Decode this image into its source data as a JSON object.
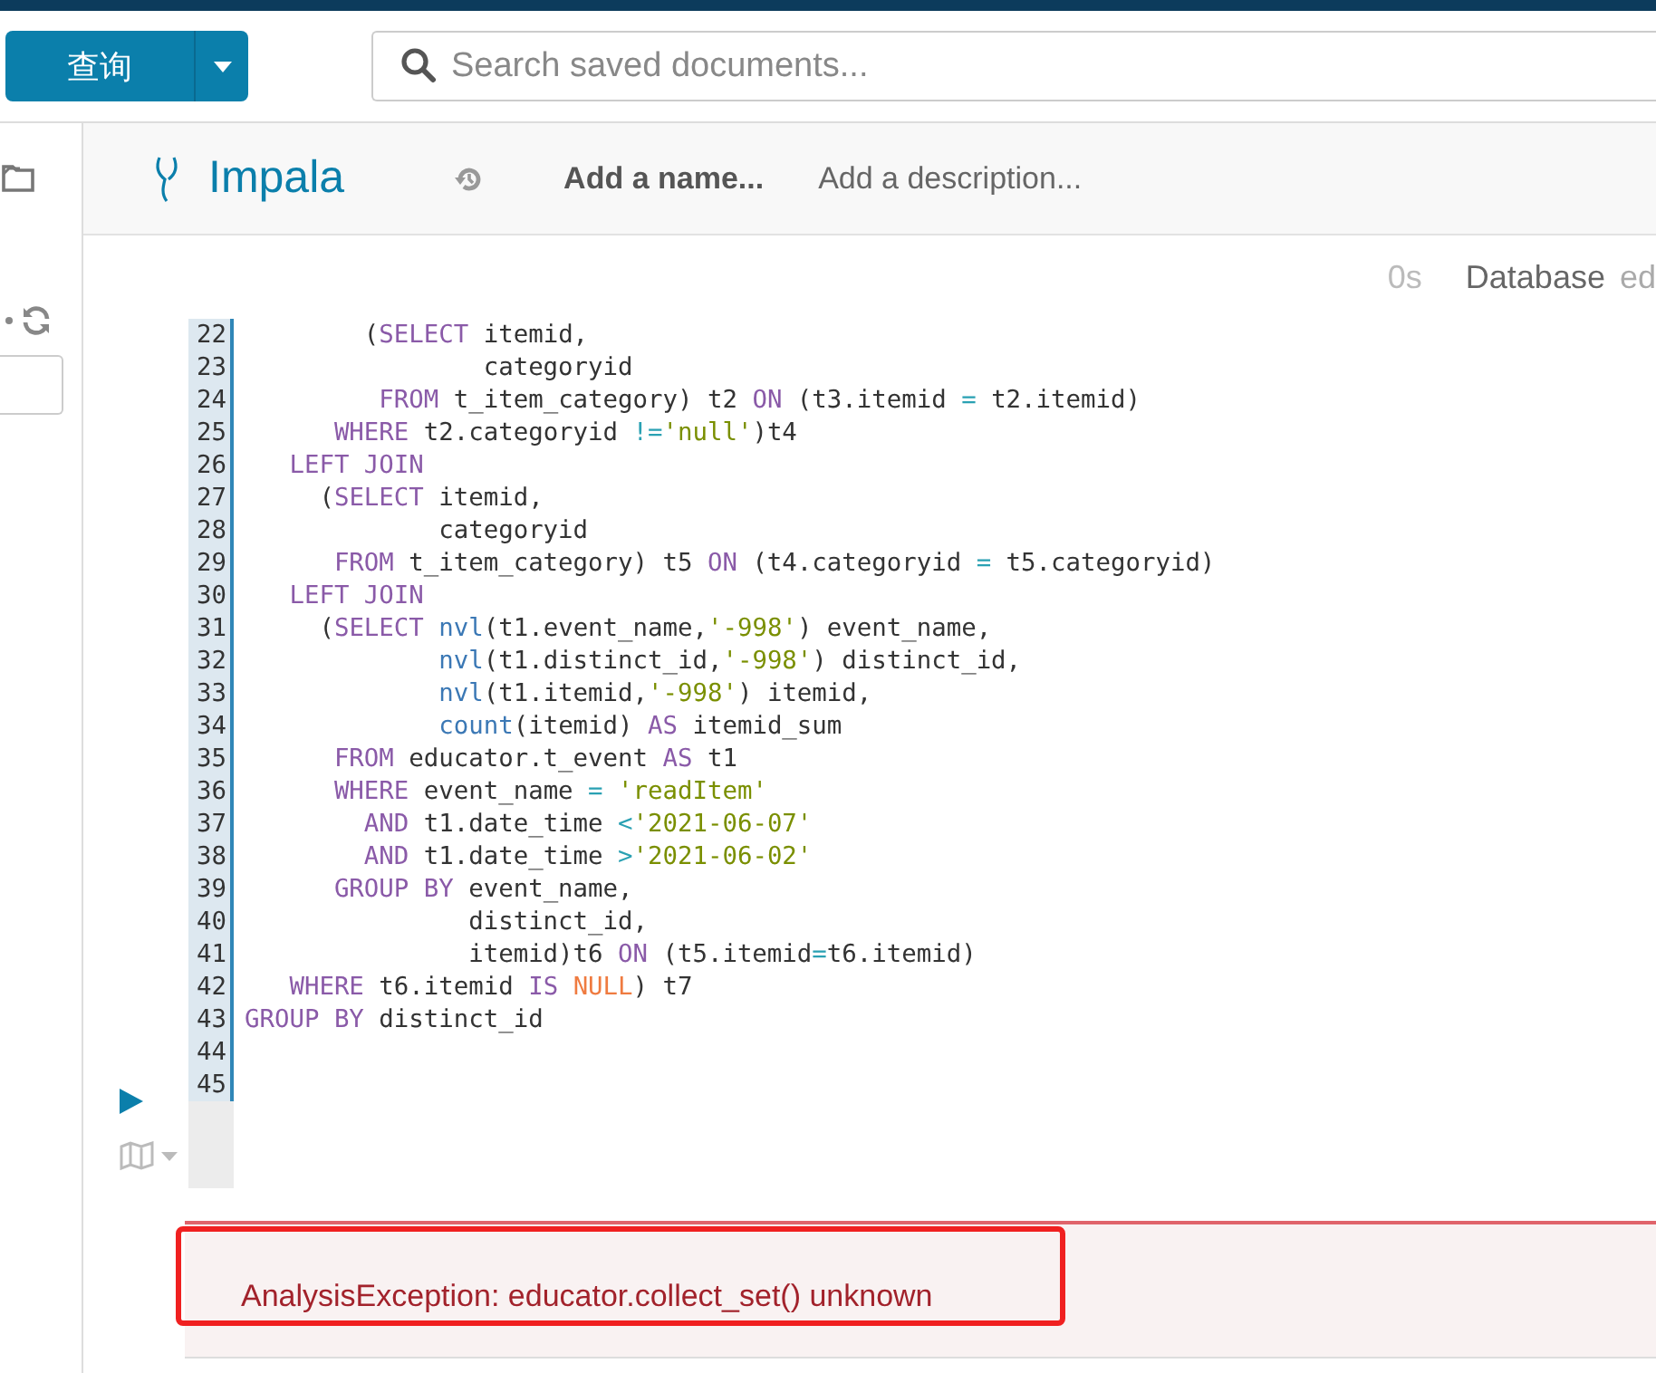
{
  "toolbar": {
    "query_button": "查询",
    "search": {
      "placeholder": "Search saved documents..."
    }
  },
  "editor_header": {
    "engine": "Impala",
    "name_placeholder": "Add a name...",
    "description_placeholder": "Add a description..."
  },
  "status": {
    "duration": "0s",
    "database_label": "Database",
    "database_value": "ed"
  },
  "code_lines": [
    {
      "number": "22",
      "segments": [
        {
          "kind": "plain",
          "text": "        ("
        },
        {
          "kind": "kw",
          "text": "SELECT"
        },
        {
          "kind": "plain",
          "text": " itemid,"
        }
      ]
    },
    {
      "number": "23",
      "segments": [
        {
          "kind": "plain",
          "text": "                categoryid"
        }
      ]
    },
    {
      "number": "24",
      "segments": [
        {
          "kind": "kw",
          "text": "         FROM"
        },
        {
          "kind": "plain",
          "text": " t_item_category) t2 "
        },
        {
          "kind": "kw",
          "text": "ON"
        },
        {
          "kind": "plain",
          "text": " (t3.itemid "
        },
        {
          "kind": "op",
          "text": "="
        },
        {
          "kind": "plain",
          "text": " t2.itemid)"
        }
      ]
    },
    {
      "number": "25",
      "segments": [
        {
          "kind": "kw",
          "text": "      WHERE"
        },
        {
          "kind": "plain",
          "text": " t2.categoryid "
        },
        {
          "kind": "op",
          "text": "!="
        },
        {
          "kind": "str",
          "text": "'null'"
        },
        {
          "kind": "plain",
          "text": ")t4"
        }
      ]
    },
    {
      "number": "26",
      "segments": [
        {
          "kind": "kw",
          "text": "   LEFT JOIN"
        }
      ]
    },
    {
      "number": "27",
      "segments": [
        {
          "kind": "plain",
          "text": "     ("
        },
        {
          "kind": "kw",
          "text": "SELECT"
        },
        {
          "kind": "plain",
          "text": " itemid,"
        }
      ]
    },
    {
      "number": "28",
      "segments": [
        {
          "kind": "plain",
          "text": "             categoryid"
        }
      ]
    },
    {
      "number": "29",
      "segments": [
        {
          "kind": "kw",
          "text": "      FROM"
        },
        {
          "kind": "plain",
          "text": " t_item_category) t5 "
        },
        {
          "kind": "kw",
          "text": "ON"
        },
        {
          "kind": "plain",
          "text": " (t4.categoryid "
        },
        {
          "kind": "op",
          "text": "="
        },
        {
          "kind": "plain",
          "text": " t5.categoryid)"
        }
      ]
    },
    {
      "number": "30",
      "segments": [
        {
          "kind": "kw",
          "text": "   LEFT JOIN"
        }
      ]
    },
    {
      "number": "31",
      "segments": [
        {
          "kind": "plain",
          "text": "     ("
        },
        {
          "kind": "kw",
          "text": "SELECT"
        },
        {
          "kind": "fn",
          "text": " nvl"
        },
        {
          "kind": "plain",
          "text": "(t1.event_name,"
        },
        {
          "kind": "str",
          "text": "'-998'"
        },
        {
          "kind": "plain",
          "text": ") event_name,"
        }
      ]
    },
    {
      "number": "32",
      "segments": [
        {
          "kind": "fn",
          "text": "             nvl"
        },
        {
          "kind": "plain",
          "text": "(t1.distinct_id,"
        },
        {
          "kind": "str",
          "text": "'-998'"
        },
        {
          "kind": "plain",
          "text": ") distinct_id,"
        }
      ]
    },
    {
      "number": "33",
      "segments": [
        {
          "kind": "fn",
          "text": "             nvl"
        },
        {
          "kind": "plain",
          "text": "(t1.itemid,"
        },
        {
          "kind": "str",
          "text": "'-998'"
        },
        {
          "kind": "plain",
          "text": ") itemid,"
        }
      ]
    },
    {
      "number": "34",
      "segments": [
        {
          "kind": "fn",
          "text": "             count"
        },
        {
          "kind": "plain",
          "text": "(itemid) "
        },
        {
          "kind": "kw",
          "text": "AS"
        },
        {
          "kind": "plain",
          "text": " itemid_sum"
        }
      ]
    },
    {
      "number": "35",
      "segments": [
        {
          "kind": "kw",
          "text": "      FROM"
        },
        {
          "kind": "plain",
          "text": " educator.t_event "
        },
        {
          "kind": "kw",
          "text": "AS"
        },
        {
          "kind": "plain",
          "text": " t1"
        }
      ]
    },
    {
      "number": "36",
      "segments": [
        {
          "kind": "kw",
          "text": "      WHERE"
        },
        {
          "kind": "plain",
          "text": " event_name "
        },
        {
          "kind": "op",
          "text": "="
        },
        {
          "kind": "str",
          "text": " 'readItem'"
        }
      ]
    },
    {
      "number": "37",
      "segments": [
        {
          "kind": "kw",
          "text": "        AND"
        },
        {
          "kind": "plain",
          "text": " t1.date_time "
        },
        {
          "kind": "op",
          "text": "<"
        },
        {
          "kind": "str",
          "text": "'2021-06-07'"
        }
      ]
    },
    {
      "number": "38",
      "segments": [
        {
          "kind": "kw",
          "text": "        AND"
        },
        {
          "kind": "plain",
          "text": " t1.date_time "
        },
        {
          "kind": "op",
          "text": ">"
        },
        {
          "kind": "str",
          "text": "'2021-06-02'"
        }
      ]
    },
    {
      "number": "39",
      "segments": [
        {
          "kind": "kw",
          "text": "      GROUP BY"
        },
        {
          "kind": "plain",
          "text": " event_name,"
        }
      ]
    },
    {
      "number": "40",
      "segments": [
        {
          "kind": "plain",
          "text": "               distinct_id,"
        }
      ]
    },
    {
      "number": "41",
      "segments": [
        {
          "kind": "plain",
          "text": "               itemid)t6 "
        },
        {
          "kind": "kw",
          "text": "ON"
        },
        {
          "kind": "plain",
          "text": " (t5.itemid"
        },
        {
          "kind": "op",
          "text": "="
        },
        {
          "kind": "plain",
          "text": "t6.itemid)"
        }
      ]
    },
    {
      "number": "42",
      "segments": [
        {
          "kind": "kw",
          "text": "   WHERE"
        },
        {
          "kind": "plain",
          "text": " t6.itemid "
        },
        {
          "kind": "kw",
          "text": "IS"
        },
        {
          "kind": "null",
          "text": " NULL"
        },
        {
          "kind": "plain",
          "text": ") t7"
        }
      ]
    },
    {
      "number": "43",
      "segments": [
        {
          "kind": "kw",
          "text": "GROUP BY"
        },
        {
          "kind": "plain",
          "text": " distinct_id"
        }
      ]
    },
    {
      "number": "44"
    },
    {
      "number": "45"
    }
  ],
  "error": {
    "message": "AnalysisException: educator.collect_set() unknown",
    "highlighted": true
  }
}
